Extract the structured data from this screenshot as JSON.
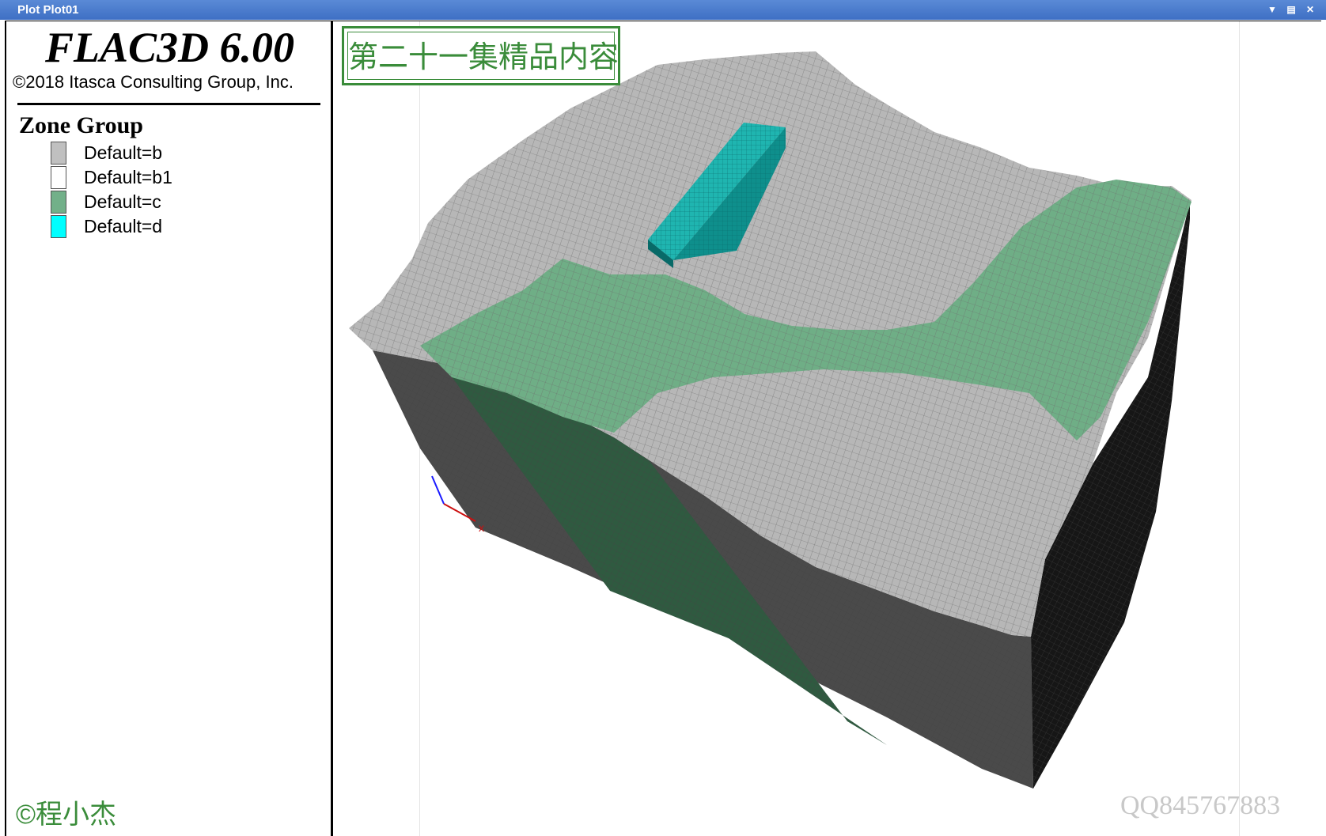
{
  "window": {
    "title": "Plot Plot01",
    "controls": [
      "chevron-down",
      "maximize",
      "close"
    ]
  },
  "legend_panel": {
    "app_name": "FLAC3D 6.00",
    "copyright": "©2018 Itasca Consulting Group, Inc.",
    "legend_title": "Zone Group",
    "items": [
      {
        "label": "Default=b",
        "color": "#c0c0c0"
      },
      {
        "label": "Default=b1",
        "color": "#ffffff"
      },
      {
        "label": "Default=c",
        "color": "#72b089"
      },
      {
        "label": "Default=d",
        "color": "#00ffff"
      }
    ],
    "author_watermark": "©程小杰"
  },
  "viewport": {
    "stamp_text": "第二十一集精品内容",
    "qq_watermark": "QQ845767883",
    "axis_label": "x"
  }
}
